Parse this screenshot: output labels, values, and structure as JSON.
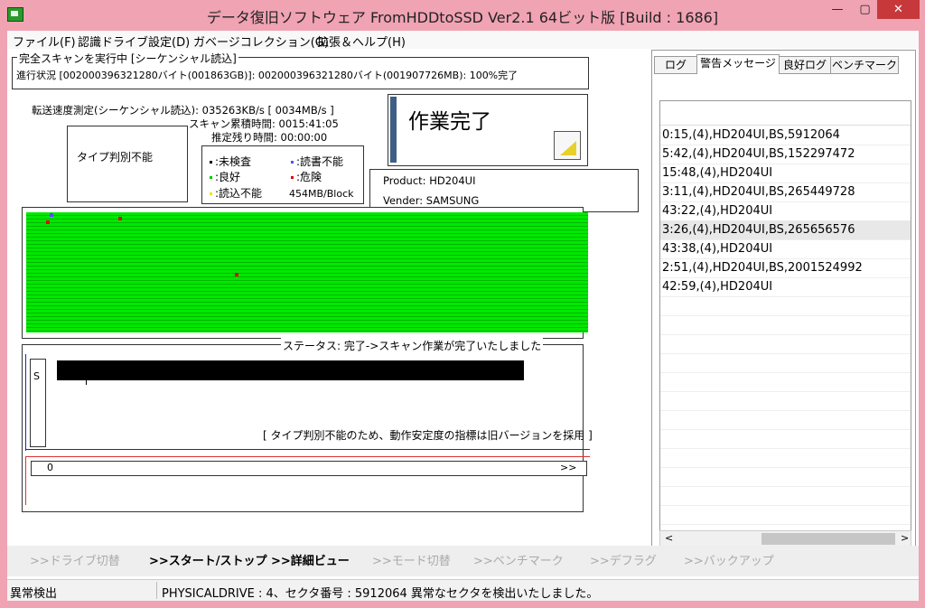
{
  "window": {
    "title": "データ復旧ソフトウェア FromHDDtoSSD Ver2.1 64ビット版 [Build : 1686]",
    "controls": {
      "minimize": "—",
      "maximize": "▢",
      "close": "✕"
    }
  },
  "menu": [
    "ファイル(F)",
    "認識ドライブ設定(D)",
    "ガベージコレクション(G)",
    "拡張＆ヘルプ(H)"
  ],
  "scan": {
    "group_title": "完全スキャンを実行中 [シーケンシャル読込]",
    "progress_text": "進行状況 [002000396321280バイト(001863GB)]: 002000396321280バイト(001907726MB): 100%完了"
  },
  "speed": {
    "transfer": "転送速度測定(シーケンシャル読込): 035263KB/s [ 0034MB/s ]",
    "elapsed": "スキャン累積時間: 0015:41:05",
    "remaining": "推定残り時間: 00:00:00"
  },
  "type_box": "タイプ判別不能",
  "legend": {
    "unchecked": ":未検査",
    "rw_fail": ":読書不能",
    "good": ":良好",
    "danger": ":危険",
    "read_fail": ":読込不能",
    "block_size": "454MB/Block"
  },
  "done_label": "作業完了",
  "device": {
    "product": "Product: HD204UI",
    "vender": "Vender: SAMSUNG"
  },
  "status": {
    "title": "ステータス: 完了->スキャン作業が完了いたしました",
    "s_label": "S",
    "note": "[ タイプ判別不能のため、動作安定度の指標は旧バージョンを採用 ]",
    "progress_start": "0",
    "progress_end": ">>"
  },
  "tabs": [
    "ログ",
    "警告メッセージ",
    "良好ログ",
    "ベンチマーク"
  ],
  "log_rows": [
    "0:15,(4),HD204UI,BS,5912064",
    "5:42,(4),HD204UI,BS,152297472",
    "15:48,(4),HD204UI",
    "3:11,(4),HD204UI,BS,265449728",
    "43:22,(4),HD204UI",
    "3:26,(4),HD204UI,BS,265656576",
    "43:38,(4),HD204UI",
    "2:51,(4),HD204UI,BS,2001524992",
    "42:59,(4),HD204UI"
  ],
  "scroll": {
    "left": "<",
    "right": ">"
  },
  "bottom_buttons": [
    ">>ドライブ切替",
    ">>スタート/ストップ",
    ">>詳細ビュー",
    ">>モード切替",
    ">>ベンチマーク",
    ">>デフラグ",
    ">>バックアップ"
  ],
  "bottom_enabled": [
    false,
    true,
    true,
    false,
    false,
    false,
    false
  ],
  "statusbar": {
    "left": "異常検出",
    "right": "PHYSICALDRIVE : 4、セクタ番号 : 5912064 異常なセクタを検出いたしました。"
  },
  "colors": {
    "frame": "#f0a3b3",
    "good": "#00e800",
    "danger": "#e00000",
    "rw_fail": "#5050ff",
    "read_fail": "#e8e800"
  }
}
